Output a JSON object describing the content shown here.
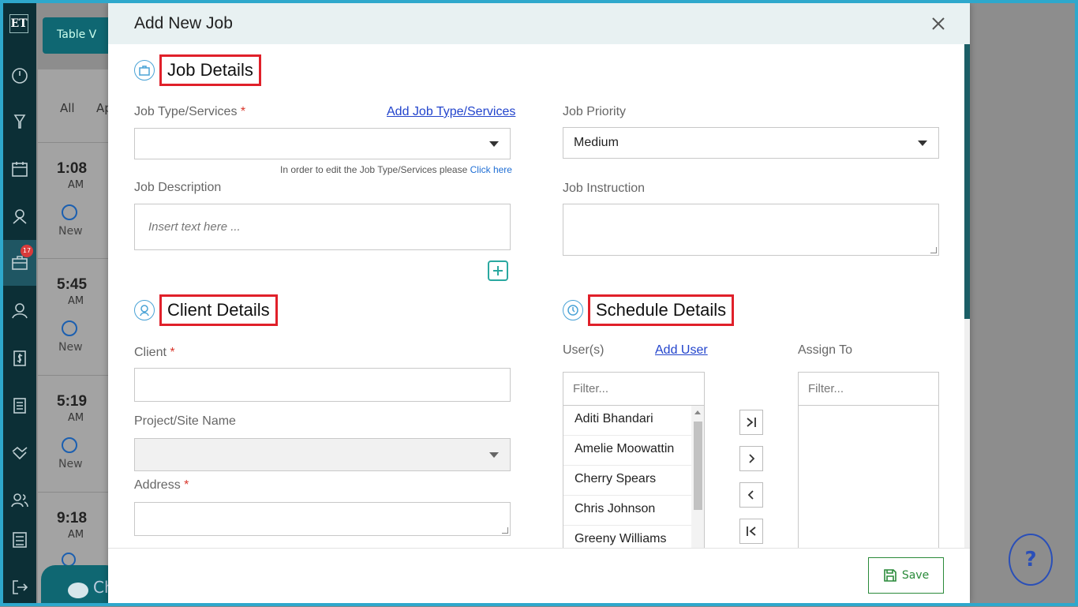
{
  "app": {
    "logo": "ET",
    "nav_badge": "17",
    "table_view_label": "Table V",
    "tabs": [
      "All",
      "Ap"
    ],
    "jobs": [
      {
        "time": "1:08",
        "ampm": "AM",
        "status": "New"
      },
      {
        "time": "5:45",
        "ampm": "AM",
        "status": "New"
      },
      {
        "time": "5:19",
        "ampm": "AM",
        "status": "New"
      },
      {
        "time": "9:18",
        "ampm": "AM",
        "status": ""
      }
    ],
    "chat_label": "Ch",
    "help_label": "?"
  },
  "modal": {
    "title": "Add New Job",
    "save_label": "Save"
  },
  "job_details": {
    "heading": "Job Details",
    "job_type_label": "Job Type/Services",
    "required_mark": "*",
    "add_job_type_link": "Add Job Type/Services",
    "job_type_value": "",
    "job_type_hint": "In order to edit the Job Type/Services please",
    "job_type_hint_link": "Click here",
    "job_priority_label": "Job Priority",
    "job_priority_value": "Medium",
    "job_description_label": "Job Description",
    "job_description_placeholder": "Insert text here ...",
    "job_instruction_label": "Job Instruction"
  },
  "client_details": {
    "heading": "Client Details",
    "client_label": "Client",
    "project_label": "Project/Site Name",
    "address_label": "Address"
  },
  "schedule_details": {
    "heading": "Schedule Details",
    "users_label": "User(s)",
    "add_user_link": "Add User",
    "assign_to_label": "Assign To",
    "filter_placeholder": "Filter...",
    "users": [
      "Aditi Bhandari",
      "Amelie Moowattin",
      "Cherry Spears",
      "Chris Johnson",
      "Greeny Williams"
    ]
  }
}
